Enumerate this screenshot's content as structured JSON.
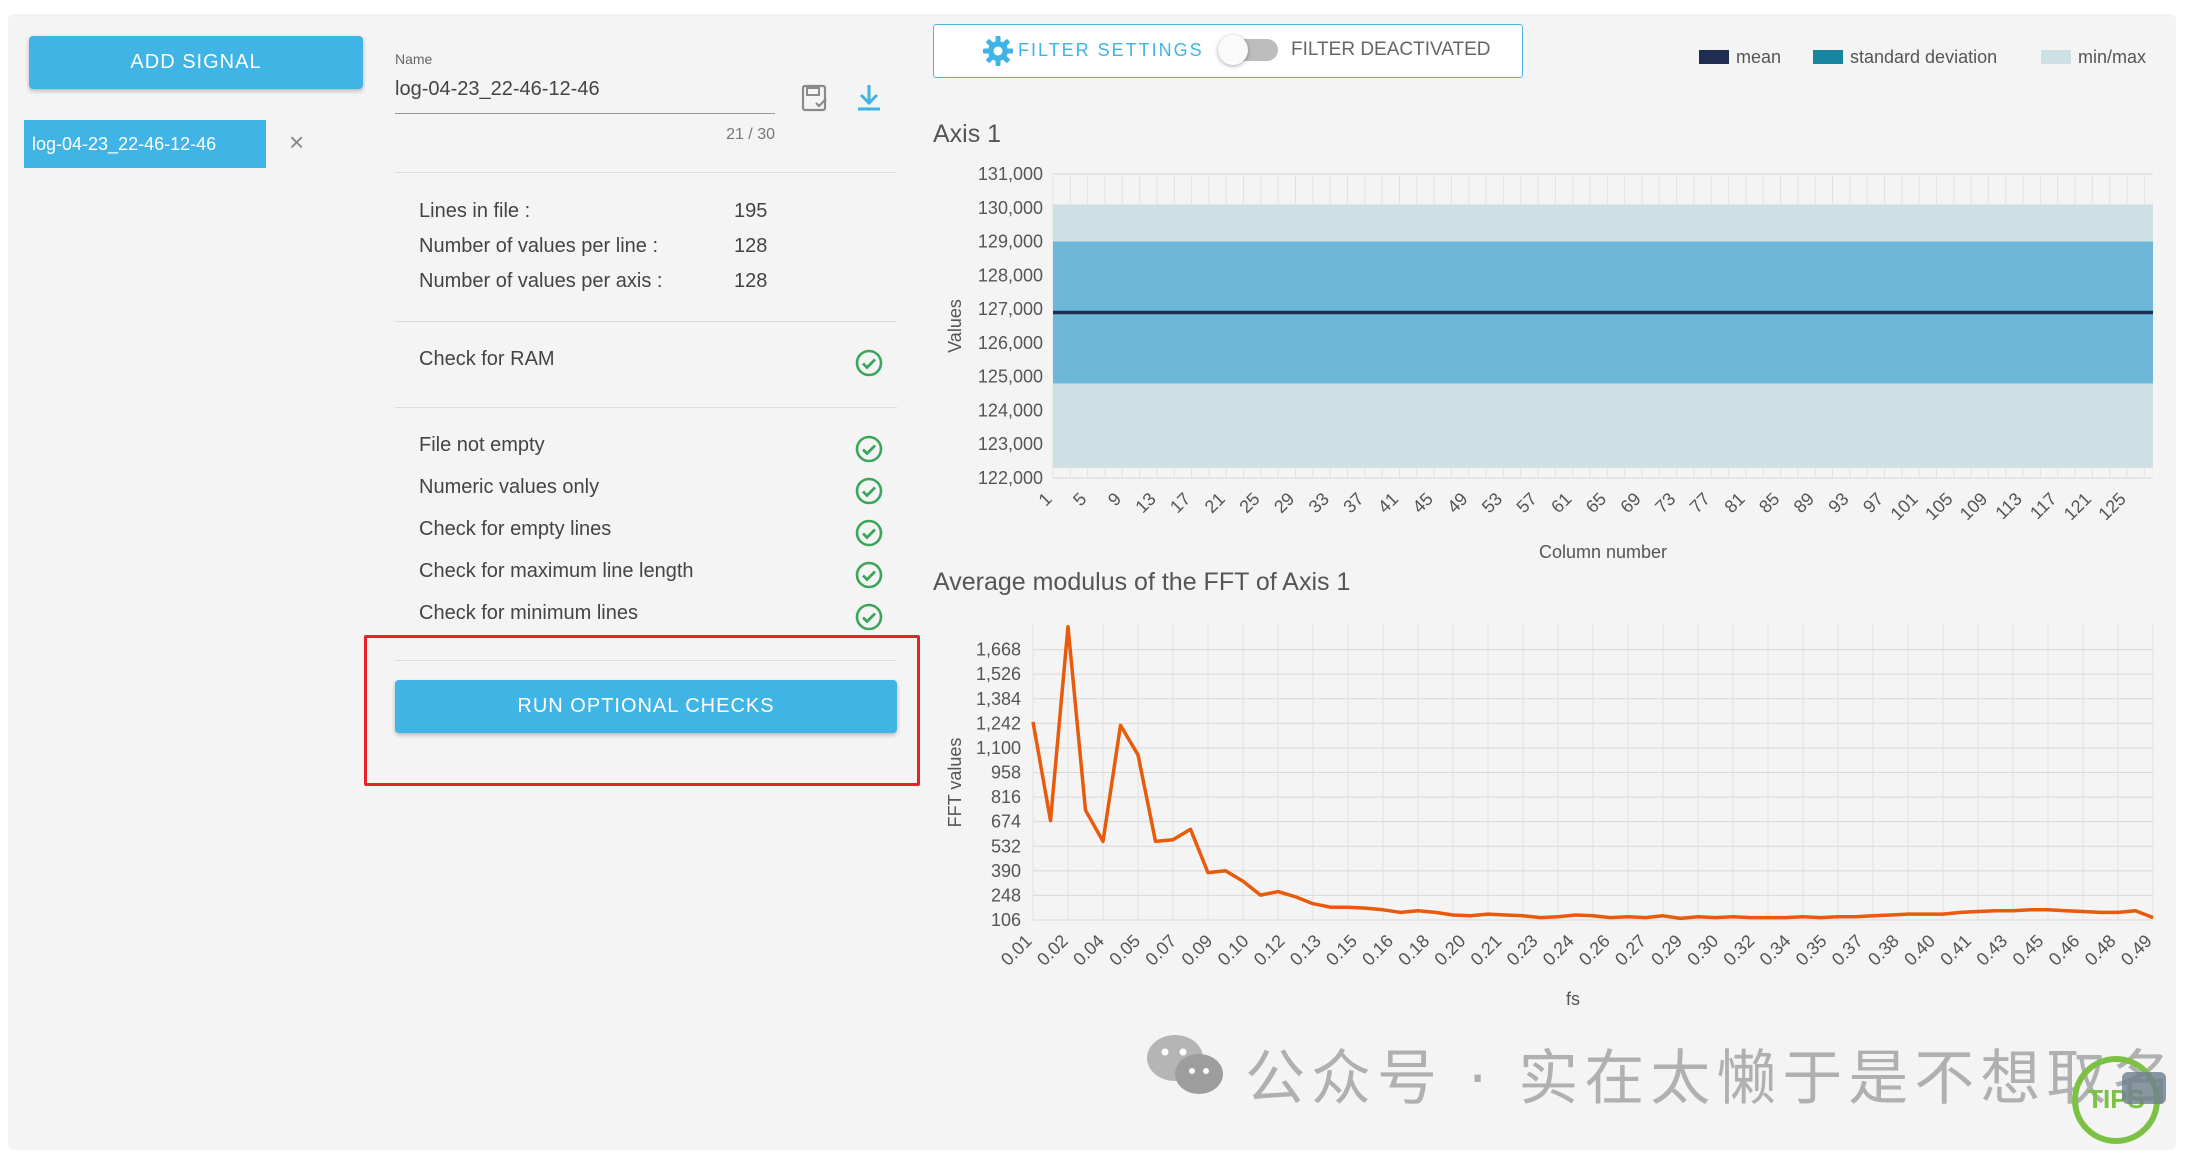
{
  "sidebar": {
    "add_signal_label": "ADD SIGNAL",
    "signals": [
      {
        "label": "log-04-23_22-46-12-46"
      }
    ],
    "remove_glyph": "×"
  },
  "details": {
    "name_label": "Name",
    "name_value": "log-04-23_22-46-12-46",
    "name_counter": "21 / 30",
    "save_icon": "save-icon",
    "download_icon": "download-icon",
    "stats": [
      {
        "label": "Lines in file :",
        "value": "195"
      },
      {
        "label": "Number of values per line :",
        "value": "128"
      },
      {
        "label": "Number of values per axis :",
        "value": "128"
      }
    ],
    "ram_check": {
      "label": "Check for RAM",
      "status": "ok"
    },
    "checks": [
      {
        "label": "File not empty",
        "status": "ok"
      },
      {
        "label": "Numeric values only",
        "status": "ok"
      },
      {
        "label": "Check for empty lines",
        "status": "ok"
      },
      {
        "label": "Check for maximum line length",
        "status": "ok"
      },
      {
        "label": "Check for minimum lines",
        "status": "ok"
      }
    ],
    "run_optional_label": "RUN OPTIONAL CHECKS"
  },
  "filter": {
    "settings_label": "FILTER SETTINGS",
    "state_label": "FILTER DEACTIVATED",
    "enabled": false
  },
  "legend": [
    {
      "label": "mean",
      "color": "#1f2d52"
    },
    {
      "label": "standard deviation",
      "color": "#1585a0"
    },
    {
      "label": "min/max",
      "color": "#cde0e6"
    }
  ],
  "colors": {
    "accent": "#3fb4e5",
    "check_ok": "#3aa65a",
    "highlight": "#e6232a",
    "fft_line": "#e85a0c",
    "std_band": "#6db8d8",
    "minmax_band": "#cfe0e4",
    "mean_line": "#1f2d52"
  },
  "watermark": {
    "text": "公众号 · 实在太懒于是不想取名"
  },
  "chart_data": [
    {
      "type": "area",
      "title": "Axis 1",
      "xlabel": "Column number",
      "ylabel": "Values",
      "ylim": [
        122000,
        131000
      ],
      "yticks": [
        "122,000",
        "123,000",
        "124,000",
        "125,000",
        "126,000",
        "127,000",
        "128,000",
        "129,000",
        "130,000",
        "131,000"
      ],
      "xticks": [
        "1",
        "5",
        "9",
        "13",
        "17",
        "21",
        "25",
        "29",
        "33",
        "37",
        "41",
        "45",
        "49",
        "53",
        "57",
        "61",
        "65",
        "69",
        "73",
        "77",
        "81",
        "85",
        "89",
        "93",
        "97",
        "101",
        "105",
        "109",
        "113",
        "117",
        "121",
        "125"
      ],
      "x_range": [
        1,
        128
      ],
      "series": [
        {
          "name": "mean",
          "value": 126900
        },
        {
          "name": "standard deviation",
          "lower": 124800,
          "upper": 129000
        },
        {
          "name": "min/max",
          "lower": 122300,
          "upper": 130100
        }
      ],
      "grid": true
    },
    {
      "type": "line",
      "title": "Average modulus of the FFT of Axis 1",
      "xlabel": "fs",
      "ylabel": "FFT values",
      "ylim": [
        106,
        1810
      ],
      "yticks": [
        "106",
        "248",
        "390",
        "532",
        "674",
        "816",
        "958",
        "1,100",
        "1,242",
        "1,384",
        "1,526",
        "1,668"
      ],
      "xticks": [
        "0.01",
        "0.02",
        "0.04",
        "0.05",
        "0.07",
        "0.09",
        "0.10",
        "0.12",
        "0.13",
        "0.15",
        "0.16",
        "0.18",
        "0.20",
        "0.21",
        "0.23",
        "0.24",
        "0.26",
        "0.27",
        "0.29",
        "0.30",
        "0.32",
        "0.34",
        "0.35",
        "0.37",
        "0.38",
        "0.40",
        "0.41",
        "0.43",
        "0.45",
        "0.46",
        "0.48",
        "0.49"
      ],
      "values": [
        1250,
        680,
        1800,
        740,
        560,
        1230,
        1060,
        560,
        570,
        630,
        380,
        390,
        330,
        250,
        270,
        240,
        200,
        180,
        180,
        175,
        165,
        150,
        160,
        150,
        135,
        130,
        140,
        135,
        130,
        120,
        125,
        135,
        130,
        120,
        125,
        120,
        130,
        115,
        125,
        120,
        125,
        120,
        120,
        120,
        125,
        120,
        125,
        125,
        130,
        135,
        140,
        140,
        140,
        150,
        155,
        160,
        160,
        165,
        165,
        160,
        155,
        150,
        150,
        160,
        120
      ],
      "grid": true
    }
  ]
}
